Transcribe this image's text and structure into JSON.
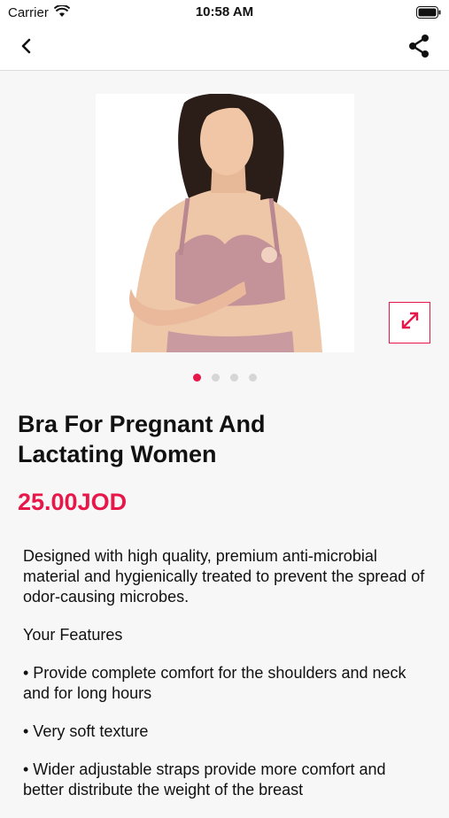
{
  "status": {
    "carrier": "Carrier",
    "time": "10:58 AM"
  },
  "nav": {
    "back_icon": "chevron-left-icon",
    "share_icon": "share-icon"
  },
  "product": {
    "image_alt": "Woman wearing a pink nursing bra",
    "pager": {
      "count": 4,
      "active": 0
    },
    "title": "Bra For Pregnant And Lactating Women",
    "price": "25.00JOD",
    "description": [
      "Designed with high quality, premium anti-microbial material and hygienically treated to prevent the spread of odor-causing microbes.",
      "Your Features",
      "• Provide complete comfort for the shoulders and neck and for long hours",
      "• Very soft texture",
      "• Wider adjustable straps provide more comfort and better distribute the weight of the breast"
    ]
  },
  "colors": {
    "accent": "#e8174a",
    "background": "#f7f7f7",
    "text": "#111111"
  }
}
